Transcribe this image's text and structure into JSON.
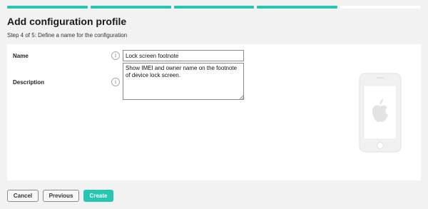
{
  "progress": {
    "steps_total": 5,
    "steps_completed": 4,
    "accent_color": "#26c6b0"
  },
  "header": {
    "title": "Add configuration profile",
    "step_text": "Step 4 of 5: Define a name for the configuration"
  },
  "form": {
    "name_label": "Name",
    "name_value": "Lock screen footnote",
    "description_label": "Description",
    "description_value": "Show IMEI and owner name on the footnote of device lock screen.",
    "info_glyph": "i"
  },
  "preview": {
    "icon": "iphone-apple-icon"
  },
  "footer": {
    "cancel_label": "Cancel",
    "previous_label": "Previous",
    "create_label": "Create"
  }
}
